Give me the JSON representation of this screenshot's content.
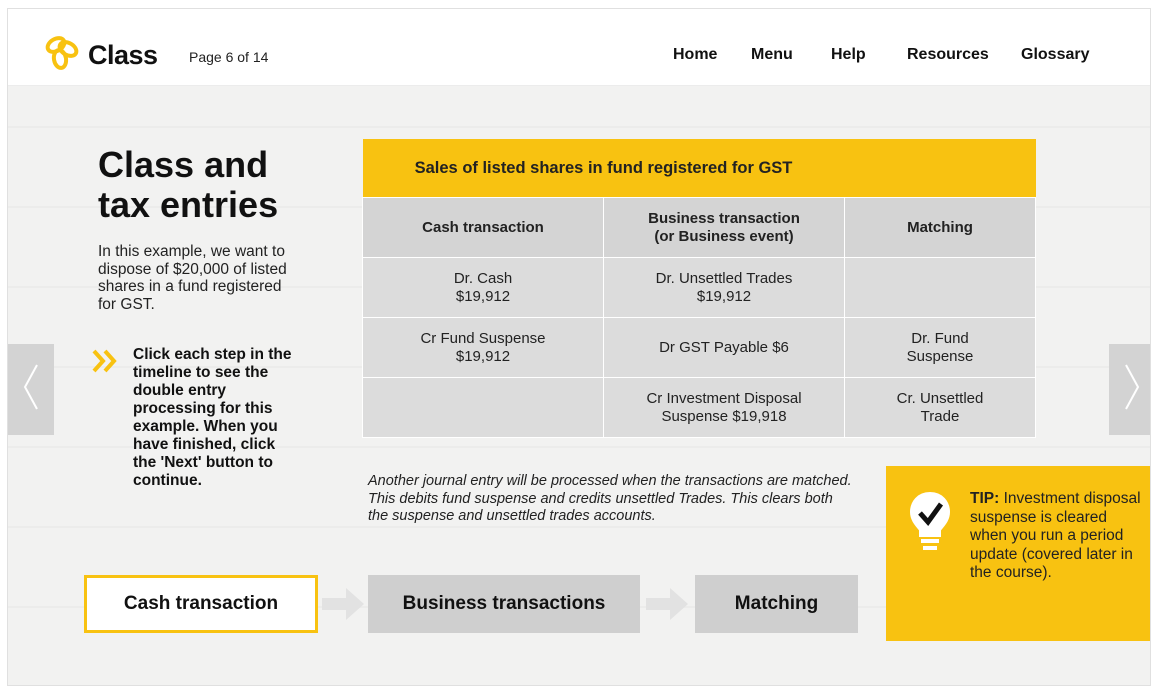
{
  "header": {
    "logo_text": "Class",
    "page_indicator": "Page 6 of 14",
    "nav": [
      "Home",
      "Menu",
      "Help",
      "Resources",
      "Glossary"
    ]
  },
  "main": {
    "title_line1": "Class and",
    "title_line2": "tax entries",
    "intro": "In this example, we want to dispose of $20,000 of listed shares in a fund registered for GST.",
    "instruction": "Click each step in the timeline to see the double entry processing for this example. When you have finished, click the 'Next' button to continue."
  },
  "table": {
    "title": "Sales of listed shares in fund registered for GST",
    "headers": {
      "cash": "Cash transaction",
      "business_line1": "Business transaction",
      "business_line2": "(or Business event)",
      "matching": "Matching"
    },
    "rows": [
      {
        "cash_l1": "Dr. Cash",
        "cash_l2": "$19,912",
        "business_l1": "Dr. Unsettled Trades",
        "business_l2": "$19,912",
        "matching_l1": "",
        "matching_l2": ""
      },
      {
        "cash_l1": "Cr Fund Suspense",
        "cash_l2": "$19,912",
        "business_l1": "Dr GST Payable $6",
        "business_l2": "",
        "matching_l1": "Dr. Fund",
        "matching_l2": "Suspense"
      },
      {
        "cash_l1": "",
        "cash_l2": "",
        "business_l1": "Cr Investment Disposal",
        "business_l2": "Suspense $19,918",
        "matching_l1": "Cr. Unsettled",
        "matching_l2": "Trade"
      }
    ]
  },
  "note": "Another journal entry will be processed when the transactions are matched. This debits fund suspense and credits unsettled Trades. This clears both the suspense and unsettled trades accounts.",
  "tip": {
    "label": "TIP:",
    "text": " Investment disposal suspense is cleared when you run a period update (covered later in the course)."
  },
  "timeline": {
    "steps": [
      "Cash transaction",
      "Business transactions",
      "Matching"
    ]
  },
  "colors": {
    "accent": "#f8c211",
    "panel_gray": "#d4d4d4",
    "background": "#f2f2f1"
  },
  "icons": [
    "class-logo-icon",
    "chevron-double-right-icon",
    "lightbulb-check-icon",
    "prev-arrow-icon",
    "next-arrow-icon",
    "timeline-chevron-icon"
  ]
}
